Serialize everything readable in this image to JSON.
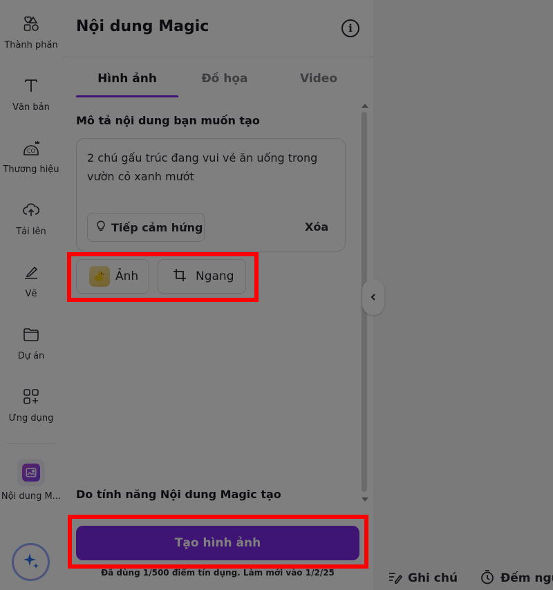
{
  "rail": {
    "items": [
      {
        "label": "Thành phần",
        "icon": "elements-icon"
      },
      {
        "label": "Văn bản",
        "icon": "text-icon"
      },
      {
        "label": "Thương hiệu",
        "icon": "brand-icon"
      },
      {
        "label": "Tải lên",
        "icon": "upload-icon"
      },
      {
        "label": "Vẽ",
        "icon": "draw-icon"
      },
      {
        "label": "Dự án",
        "icon": "folder-icon"
      },
      {
        "label": "Ứng dụng",
        "icon": "apps-icon"
      }
    ],
    "magic_label": "Nội dung M..."
  },
  "panel": {
    "title": "Nội dung Magic",
    "tabs": [
      {
        "label": "Hình ảnh",
        "active": true
      },
      {
        "label": "Đồ họa",
        "active": false
      },
      {
        "label": "Video",
        "active": false
      }
    ],
    "prompt_label": "Mô tả nội dung bạn muốn tạo",
    "prompt_value": "2 chú gấu trúc đang vui vẻ ăn uống trong vườn cỏ xanh mướt",
    "inspire_label": "Tiếp cảm hứng",
    "clear_label": "Xóa",
    "style_label": "Ảnh",
    "aspect_label": "Ngang",
    "footer_label": "Do tính năng Nội dung Magic tạo",
    "generate_label": "Tạo hình ảnh",
    "credits_text": "Đã dùng 1/500 điểm tín dụng. Làm mới vào 1/2/25"
  },
  "bottom_bar": {
    "notes_label": "Ghi chú",
    "timer_label": "Đếm ngư"
  },
  "colors": {
    "accent": "#7d2ae8",
    "highlight": "#ff0000"
  }
}
